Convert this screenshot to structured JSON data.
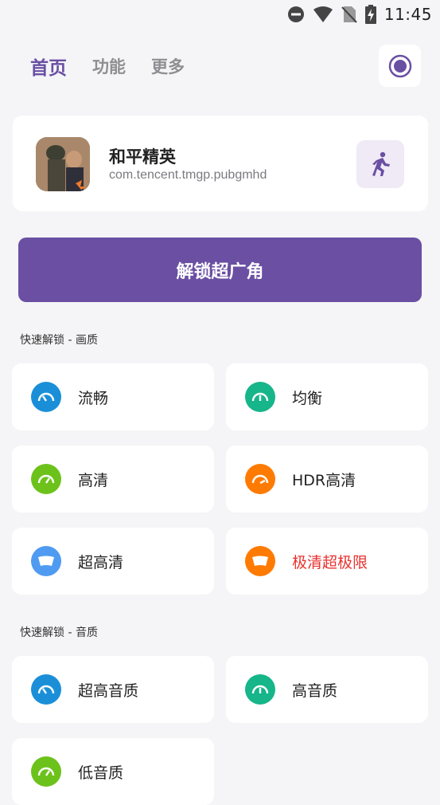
{
  "status_bar": {
    "time": "11:45"
  },
  "tabs": [
    {
      "label": "首页",
      "active": true
    },
    {
      "label": "功能",
      "active": false
    },
    {
      "label": "更多",
      "active": false
    }
  ],
  "app": {
    "name": "和平精英",
    "package": "com.tencent.tmgp.pubgmhd"
  },
  "unlock_button": "解锁超广角",
  "sections": {
    "quality": {
      "label": "快速解锁 - 画质",
      "items": [
        {
          "label": "流畅",
          "color": "#1a8fd8"
        },
        {
          "label": "均衡",
          "color": "#16b58a"
        },
        {
          "label": "高清",
          "color": "#6cc21b"
        },
        {
          "label": "HDR高清",
          "color": "#ff7a00"
        },
        {
          "label": "超高清",
          "color": "#4f9bf2"
        },
        {
          "label": "极清超极限",
          "color": "#ff7a00",
          "label_color": "#e8322f"
        }
      ]
    },
    "audio": {
      "label": "快速解锁 - 音质",
      "items": [
        {
          "label": "超高音质",
          "color": "#1a8fd8"
        },
        {
          "label": "高音质",
          "color": "#16b58a"
        },
        {
          "label": "低音质",
          "color": "#6cc21b"
        }
      ]
    }
  },
  "colors": {
    "accent": "#6a4fa3",
    "background": "#f5f5f7"
  }
}
